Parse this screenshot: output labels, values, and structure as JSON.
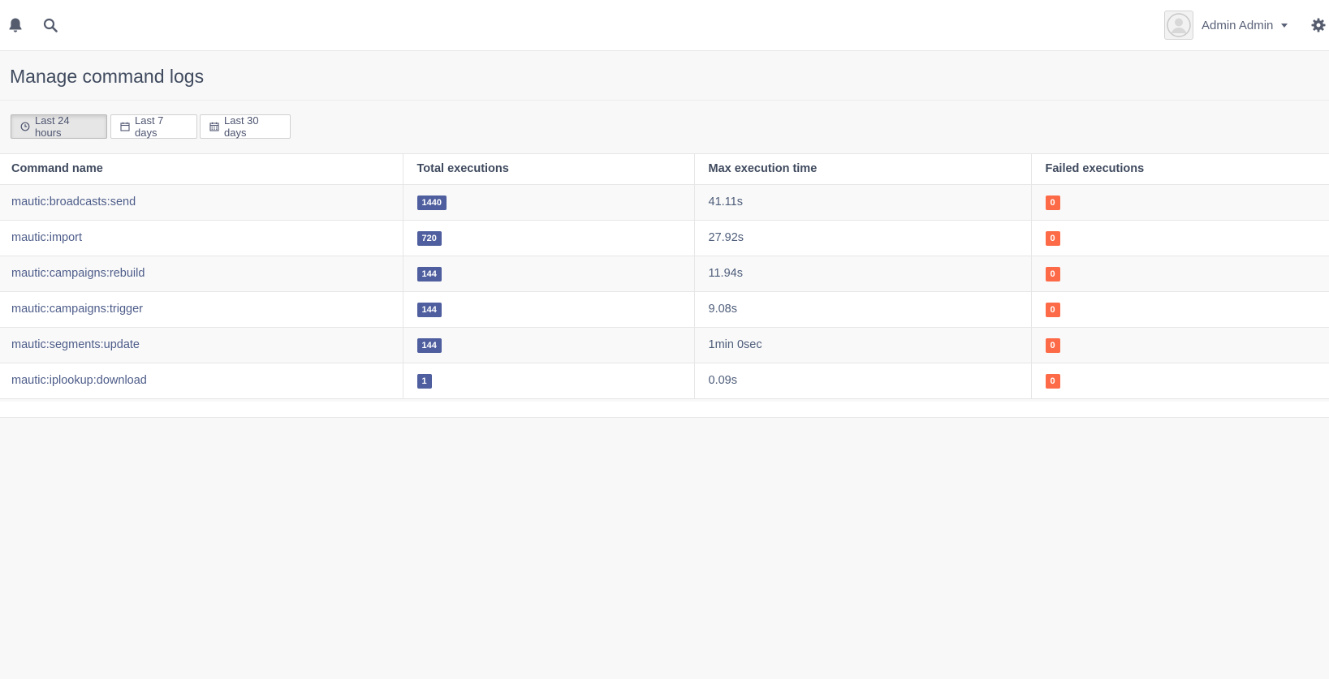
{
  "header": {
    "user_name": "Admin Admin",
    "icons": [
      "bell-icon",
      "search-icon",
      "avatar",
      "chevron-down-icon",
      "gear-icon"
    ]
  },
  "page": {
    "title": "Manage command logs"
  },
  "filters": {
    "last_24h": "Last 24 hours",
    "last_7d": "Last 7 days",
    "last_30d": "Last 30 days",
    "active": "last_24h"
  },
  "table": {
    "headers": {
      "command": "Command name",
      "total": "Total executions",
      "max_time": "Max execution time",
      "failed": "Failed executions"
    },
    "rows": [
      {
        "command": "mautic:broadcasts:send",
        "total": "1440",
        "max_time": "41.11s",
        "failed": "0"
      },
      {
        "command": "mautic:import",
        "total": "720",
        "max_time": "27.92s",
        "failed": "0"
      },
      {
        "command": "mautic:campaigns:rebuild",
        "total": "144",
        "max_time": "11.94s",
        "failed": "0"
      },
      {
        "command": "mautic:campaigns:trigger",
        "total": "144",
        "max_time": "9.08s",
        "failed": "0"
      },
      {
        "command": "mautic:segments:update",
        "total": "144",
        "max_time": "1min 0sec",
        "failed": "0"
      },
      {
        "command": "mautic:iplookup:download",
        "total": "1",
        "max_time": "0.09s",
        "failed": "0"
      }
    ]
  },
  "colors": {
    "badge_blue": "#4e5e9e",
    "badge_red": "#fd6a47",
    "link": "#4e5d8a"
  }
}
